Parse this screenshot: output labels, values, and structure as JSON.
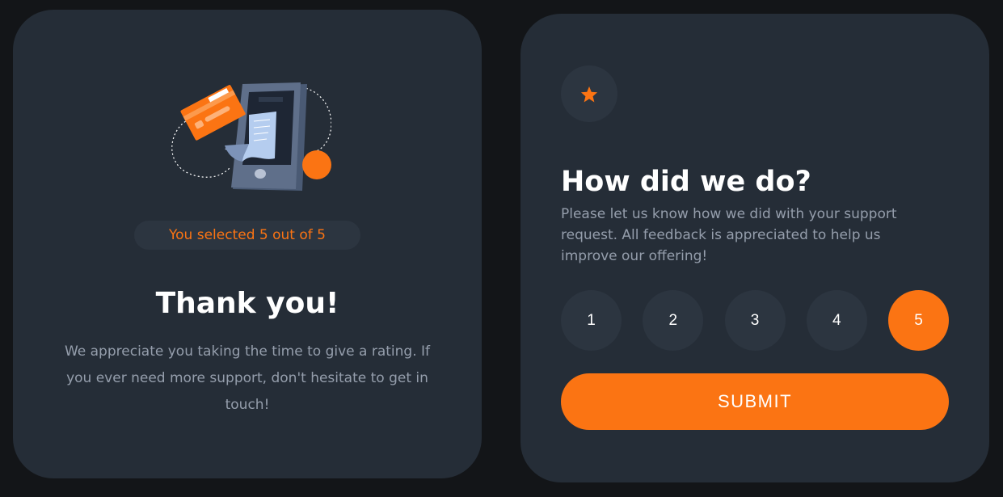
{
  "colors": {
    "background": "#131518",
    "card": "#252d37",
    "accent": "#fb7413",
    "muted_text": "#959eac",
    "circle": "#2c3540"
  },
  "thank_you": {
    "illustration": "payment-phone-card-illustration",
    "selected_text": "You selected 5 out of 5",
    "title": "Thank you!",
    "message": "We appreciate you taking the time to give a rating. If you ever need more support, don't hesitate to get in touch!"
  },
  "rating": {
    "icon": "star-icon",
    "title": "How did we do?",
    "description": "Please let us know how we did with your support request. All feedback is appreciated to help us improve our offering!",
    "options": [
      "1",
      "2",
      "3",
      "4",
      "5"
    ],
    "selected": "5",
    "submit_label": "SUBMIT"
  }
}
